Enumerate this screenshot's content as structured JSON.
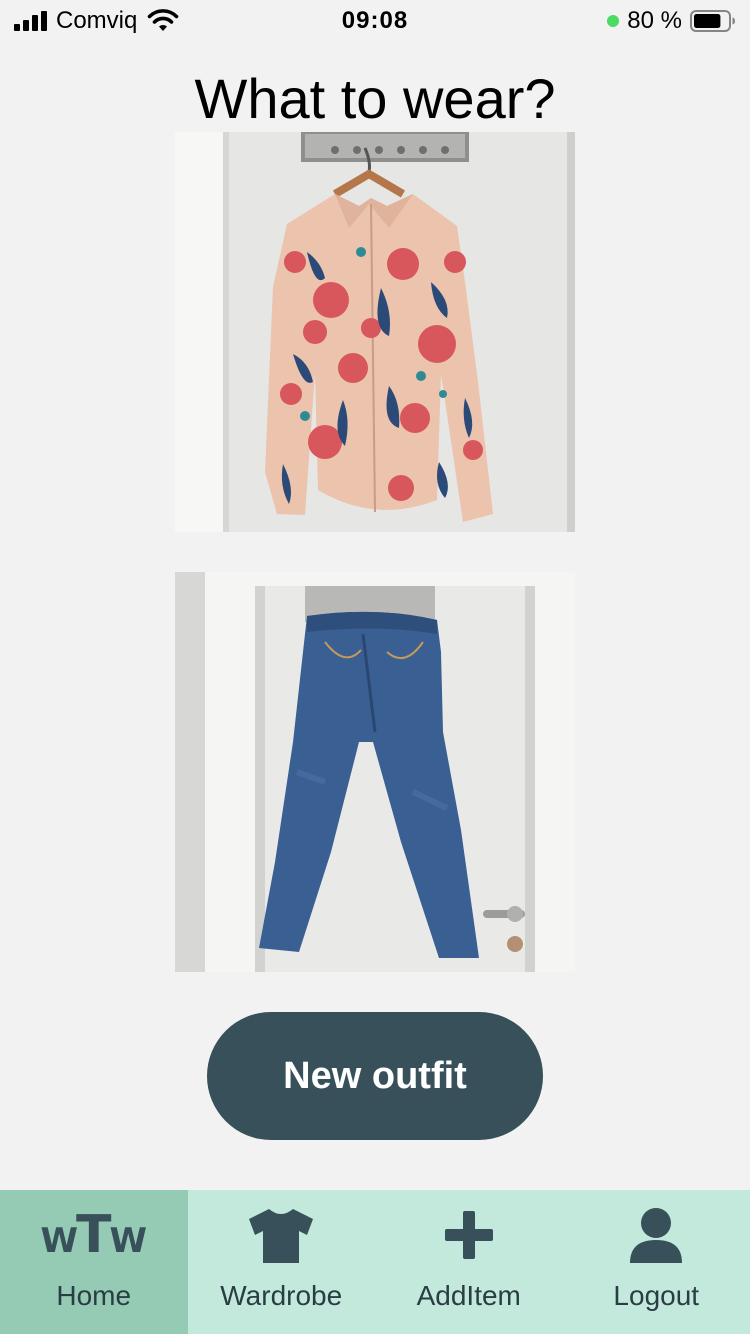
{
  "status_bar": {
    "carrier": "Comviq",
    "time": "09:08",
    "battery_percent": "80 %",
    "battery_level": 0.8,
    "icons": [
      "signal-bars-icon",
      "wifi-icon",
      "battery-icon"
    ],
    "location_dot_color": "#4cd964"
  },
  "page": {
    "title": "What to wear?"
  },
  "outfit": {
    "top_item": "floral shirt",
    "bottom_item": "blue jeans"
  },
  "new_outfit_button": {
    "label": "New outfit"
  },
  "tabbar": {
    "tabs": [
      {
        "label": "Home",
        "icon": "wtw-logo-icon",
        "logo_text": [
          "W",
          "T",
          "W"
        ],
        "active": true
      },
      {
        "label": "Wardrobe",
        "icon": "tshirt-icon",
        "active": false
      },
      {
        "label": "AddItem",
        "icon": "plus-icon",
        "active": false
      },
      {
        "label": "Logout",
        "icon": "user-icon",
        "active": false
      }
    ]
  },
  "colors": {
    "background": "#f2f2f2",
    "primary": "#37505a",
    "tabbar_bg": "#c3e9dc",
    "tab_active_bg": "#95cab5",
    "tab_label": "#2a3d44"
  }
}
